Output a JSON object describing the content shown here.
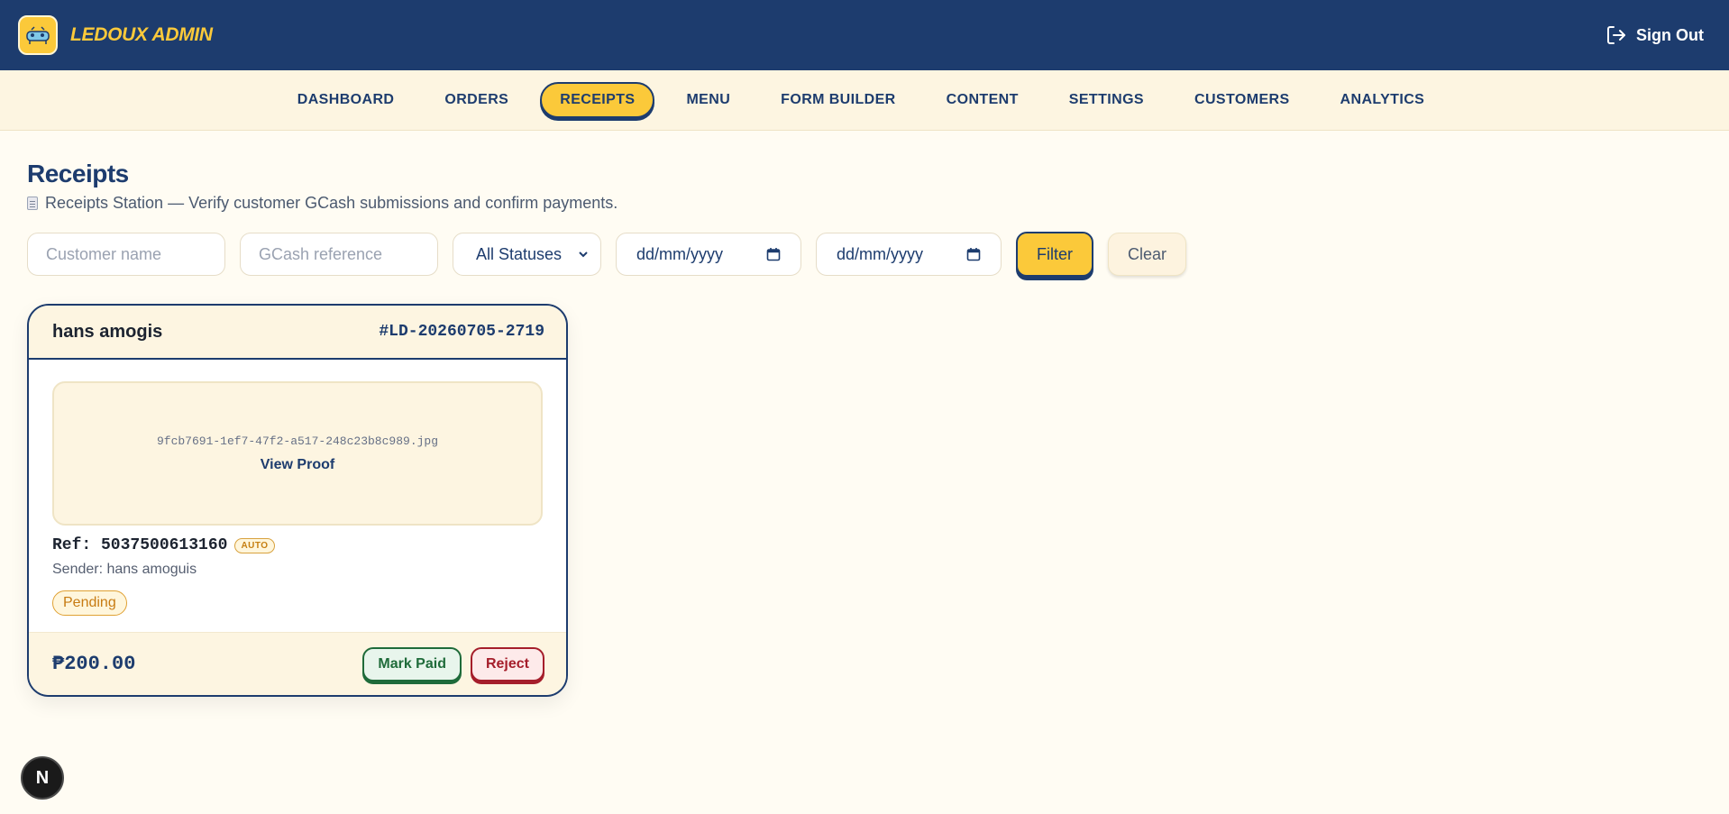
{
  "header": {
    "brand": "LEDOUX ADMIN",
    "signout_label": "Sign Out"
  },
  "nav": {
    "items": [
      {
        "label": "DASHBOARD",
        "active": false
      },
      {
        "label": "ORDERS",
        "active": false
      },
      {
        "label": "RECEIPTS",
        "active": true
      },
      {
        "label": "MENU",
        "active": false
      },
      {
        "label": "FORM BUILDER",
        "active": false
      },
      {
        "label": "CONTENT",
        "active": false
      },
      {
        "label": "SETTINGS",
        "active": false
      },
      {
        "label": "CUSTOMERS",
        "active": false
      },
      {
        "label": "ANALYTICS",
        "active": false
      }
    ]
  },
  "page": {
    "title": "Receipts",
    "subtitle": "Receipts Station — Verify customer GCash submissions and confirm payments."
  },
  "filters": {
    "customer_placeholder": "Customer name",
    "gcash_placeholder": "GCash reference",
    "status_value": "All Statuses",
    "date_from": "dd/mm/yyyy",
    "date_to": "dd/mm/yyyy",
    "filter_label": "Filter",
    "clear_label": "Clear"
  },
  "receipts": [
    {
      "customer": "hans amogis",
      "order_id": "#LD-20260705-2719",
      "proof_filename": "9fcb7691-1ef7-47f2-a517-248c23b8c989.jpg",
      "view_proof_label": "View Proof",
      "reference": "Ref: 5037500613160",
      "reference_badge": "AUTO",
      "sender": "Sender: hans amoguis",
      "status": "Pending",
      "amount": "₱200.00",
      "mark_paid_label": "Mark Paid",
      "reject_label": "Reject"
    }
  ],
  "fab": {
    "label": "N"
  },
  "colors": {
    "navy": "#1d3c6e",
    "accent_yellow": "#fbc93a",
    "cream": "#fdf5e1",
    "pending": "#c77b12",
    "success": "#1f6b3a",
    "danger": "#a51e2b"
  }
}
